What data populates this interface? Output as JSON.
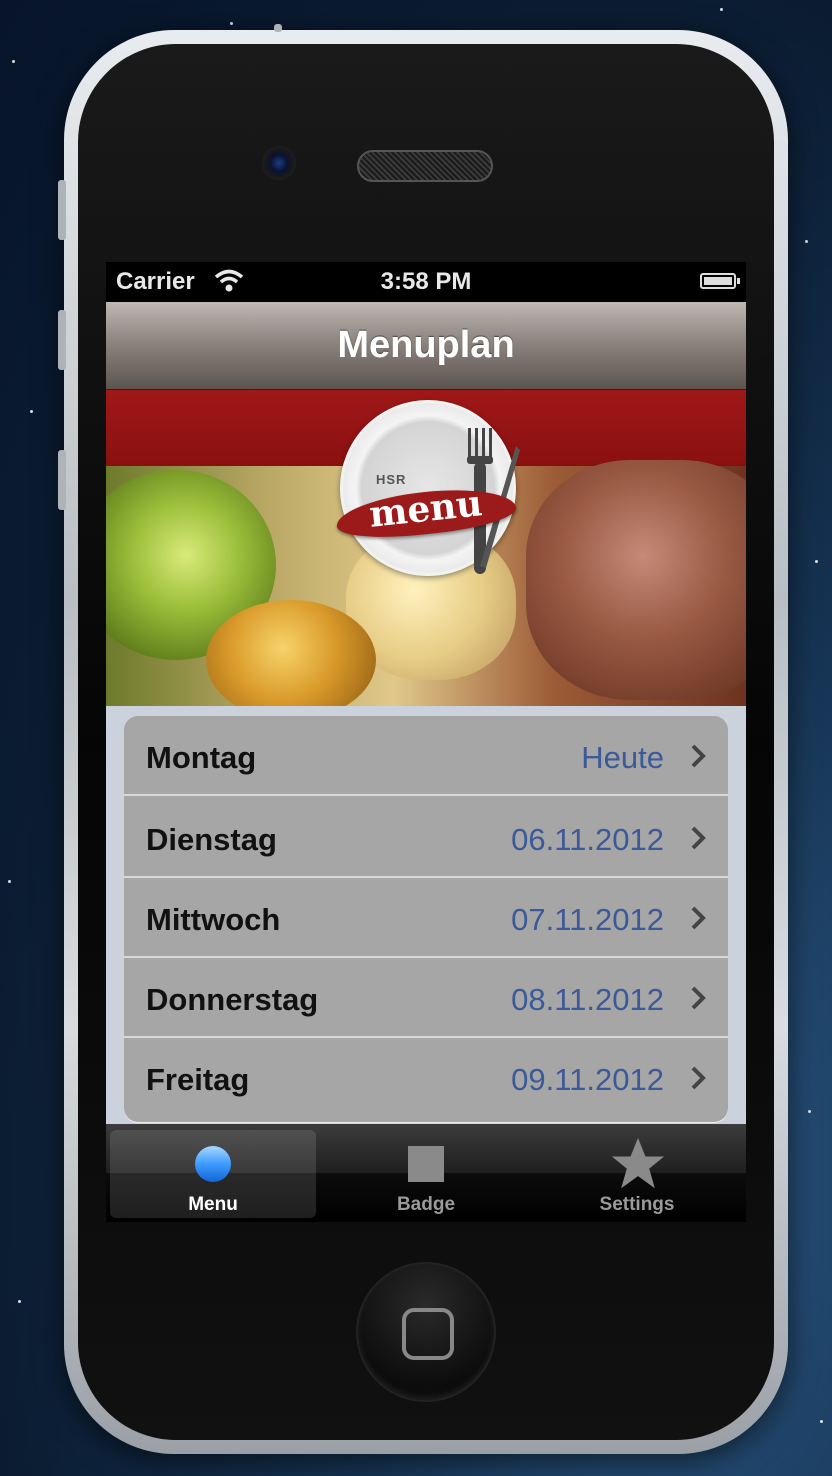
{
  "status_bar": {
    "carrier": "Carrier",
    "time": "3:58 PM"
  },
  "nav": {
    "title": "Menuplan"
  },
  "logo": {
    "small_text": "HSR",
    "main_text": "menu"
  },
  "days": [
    {
      "day": "Montag",
      "date": "Heute"
    },
    {
      "day": "Dienstag",
      "date": "06.11.2012"
    },
    {
      "day": "Mittwoch",
      "date": "07.11.2012"
    },
    {
      "day": "Donnerstag",
      "date": "08.11.2012"
    },
    {
      "day": "Freitag",
      "date": "09.11.2012"
    }
  ],
  "tabs": [
    {
      "label": "Menu",
      "icon": "circle-icon",
      "active": true
    },
    {
      "label": "Badge",
      "icon": "square-icon",
      "active": false
    },
    {
      "label": "Settings",
      "icon": "star-icon",
      "active": false
    }
  ],
  "colors": {
    "accent_red": "#9c1a1a",
    "date_blue": "#3a5a9a",
    "tab_active_blue": "#2f8cff"
  }
}
